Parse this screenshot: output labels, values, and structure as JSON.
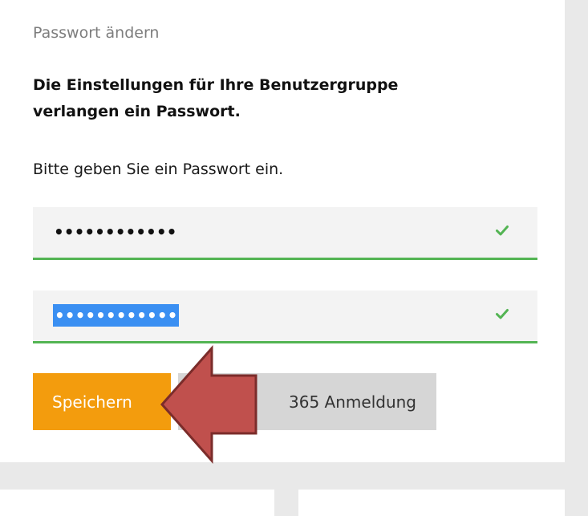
{
  "dialog": {
    "title": "Passwort ändern",
    "notice": "Die Einstellungen für Ihre Benutzergruppe verlangen ein Passwort.",
    "instruction": "Bitte geben Sie ein Passwort ein."
  },
  "fields": [
    {
      "value": "••••••••••••",
      "valid": true,
      "selected": false
    },
    {
      "value": "••••••••••••",
      "valid": true,
      "selected": true
    }
  ],
  "buttons": {
    "save_label": "Speichern",
    "microsoft_label": "365 Anmeldung"
  },
  "colors": {
    "accent": "#f39c0d",
    "valid": "#53b453",
    "selection": "#3a8ff2",
    "annotation_arrow": "#c0504d"
  },
  "annotation": {
    "icon": "arrow-left-icon"
  }
}
